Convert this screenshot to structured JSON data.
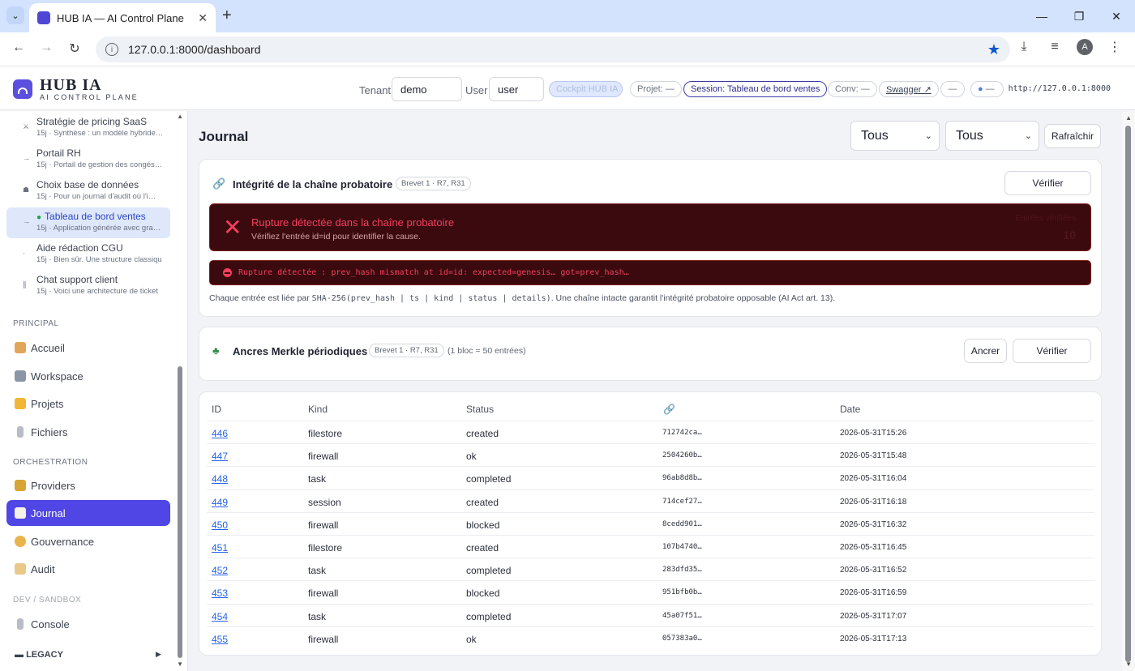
{
  "browser": {
    "tab_title": "HUB IA — AI Control Plane",
    "url": "127.0.0.1:8000/dashboard",
    "avatar_letter": "A"
  },
  "header": {
    "logo_title": "HUB IA",
    "logo_subtitle": "AI CONTROL PLANE",
    "tenant_label": "Tenant",
    "tenant_value": "demo",
    "user_label": "User",
    "user_value": "user",
    "cockpit_label": "Cockpit HUB IA",
    "project_label": "Projet: —",
    "session_label": "Session: Tableau de bord ventes",
    "conv_label": "Conv: —",
    "swagger_label": "Swagger ↗",
    "dash_pill": "—",
    "status_pill": "—",
    "api_url": "http://127.0.0.1:8000"
  },
  "sidebar": {
    "conversations": [
      {
        "icon": "⚔",
        "title": "Stratégie de pricing SaaS",
        "sub": "15j · Synthèse : un modèle hybride…",
        "active": false
      },
      {
        "icon": "→",
        "title": "Portail RH",
        "sub": "15j · Portail de gestion des congés…",
        "active": false
      },
      {
        "icon": "☗",
        "title": "Choix base de données",
        "sub": "15j · Pour un journal d'audit où l'i…",
        "active": false
      },
      {
        "icon": "→",
        "title": "Tableau de bord ventes",
        "sub": "15j · Application générée avec gra…",
        "active": true
      },
      {
        "icon": "·",
        "title": "Aide rédaction CGU",
        "sub": "15j · Bien sûr. Une structure classiqu",
        "active": false
      },
      {
        "icon": "∥",
        "title": "Chat support client",
        "sub": "15j · Voici une architecture de ticket",
        "active": false
      }
    ],
    "section_principal": "PRINCIPAL",
    "nav_principal": [
      "Accueil",
      "Workspace",
      "Projets",
      "Fichiers"
    ],
    "section_orchestration": "ORCHESTRATION",
    "nav_orchestration": [
      "Providers",
      "Journal",
      "Gouvernance",
      "Audit"
    ],
    "section_dev": "DEV / SANDBOX",
    "nav_dev": [
      "Console"
    ],
    "legacy_label": "LEGACY",
    "colors": {
      "active_nav": "#4f46e5",
      "active_conv": "#dfe7fb"
    }
  },
  "main": {
    "title": "Journal",
    "filter_kind": "Tous",
    "filter_status": "Tous",
    "refresh_label": "Rafraîchir",
    "chain_card": {
      "title": "Intégrité de la chaîne probatoire",
      "tag": "Brevet 1 · R7, R31",
      "verify_label": "Vérifier",
      "alert_title": "Rupture détectée dans la chaîne probatoire",
      "alert_sub": "Vérifiez l'entrée id=id pour identifier la cause.",
      "alert_faint_label": "Entrées vérifiées",
      "alert_faint_value": "10",
      "error_text": "Rupture détectée : prev_hash mismatch at id=id: expected=genesis… got=prev_hash…",
      "note_prefix": "Chaque entrée est liée par ",
      "note_code": "SHA-256(prev_hash | ts | kind | status | details)",
      "note_suffix": ". Une chaîne intacte garantit l'intégrité probatoire opposable (AI Act art. 13)."
    },
    "merkle_card": {
      "title": "Ancres Merkle périodiques",
      "tag": "Brevet 1 · R7, R31",
      "block_note": "(1 bloc = 50 entrées)",
      "anchor_label": "Ancrer",
      "verify_label": "Vérifier"
    },
    "table": {
      "headers": {
        "id": "ID",
        "kind": "Kind",
        "status": "Status",
        "hash_icon": "link-icon",
        "date": "Date"
      },
      "rows": [
        {
          "id": "446",
          "kind": "filestore",
          "status": "created",
          "hash": "712742ca…",
          "date": "2026-05-31T15:26"
        },
        {
          "id": "447",
          "kind": "firewall",
          "status": "ok",
          "hash": "2504260b…",
          "date": "2026-05-31T15:48"
        },
        {
          "id": "448",
          "kind": "task",
          "status": "completed",
          "hash": "96ab8d8b…",
          "date": "2026-05-31T16:04"
        },
        {
          "id": "449",
          "kind": "session",
          "status": "created",
          "hash": "714cef27…",
          "date": "2026-05-31T16:18"
        },
        {
          "id": "450",
          "kind": "firewall",
          "status": "blocked",
          "hash": "8cedd901…",
          "date": "2026-05-31T16:32"
        },
        {
          "id": "451",
          "kind": "filestore",
          "status": "created",
          "hash": "107b4740…",
          "date": "2026-05-31T16:45"
        },
        {
          "id": "452",
          "kind": "task",
          "status": "completed",
          "hash": "283dfd35…",
          "date": "2026-05-31T16:52"
        },
        {
          "id": "453",
          "kind": "firewall",
          "status": "blocked",
          "hash": "951bfb0b…",
          "date": "2026-05-31T16:59"
        },
        {
          "id": "454",
          "kind": "task",
          "status": "completed",
          "hash": "45a07f51…",
          "date": "2026-05-31T17:07"
        },
        {
          "id": "455",
          "kind": "firewall",
          "status": "ok",
          "hash": "057383a0…",
          "date": "2026-05-31T17:13"
        }
      ]
    }
  }
}
